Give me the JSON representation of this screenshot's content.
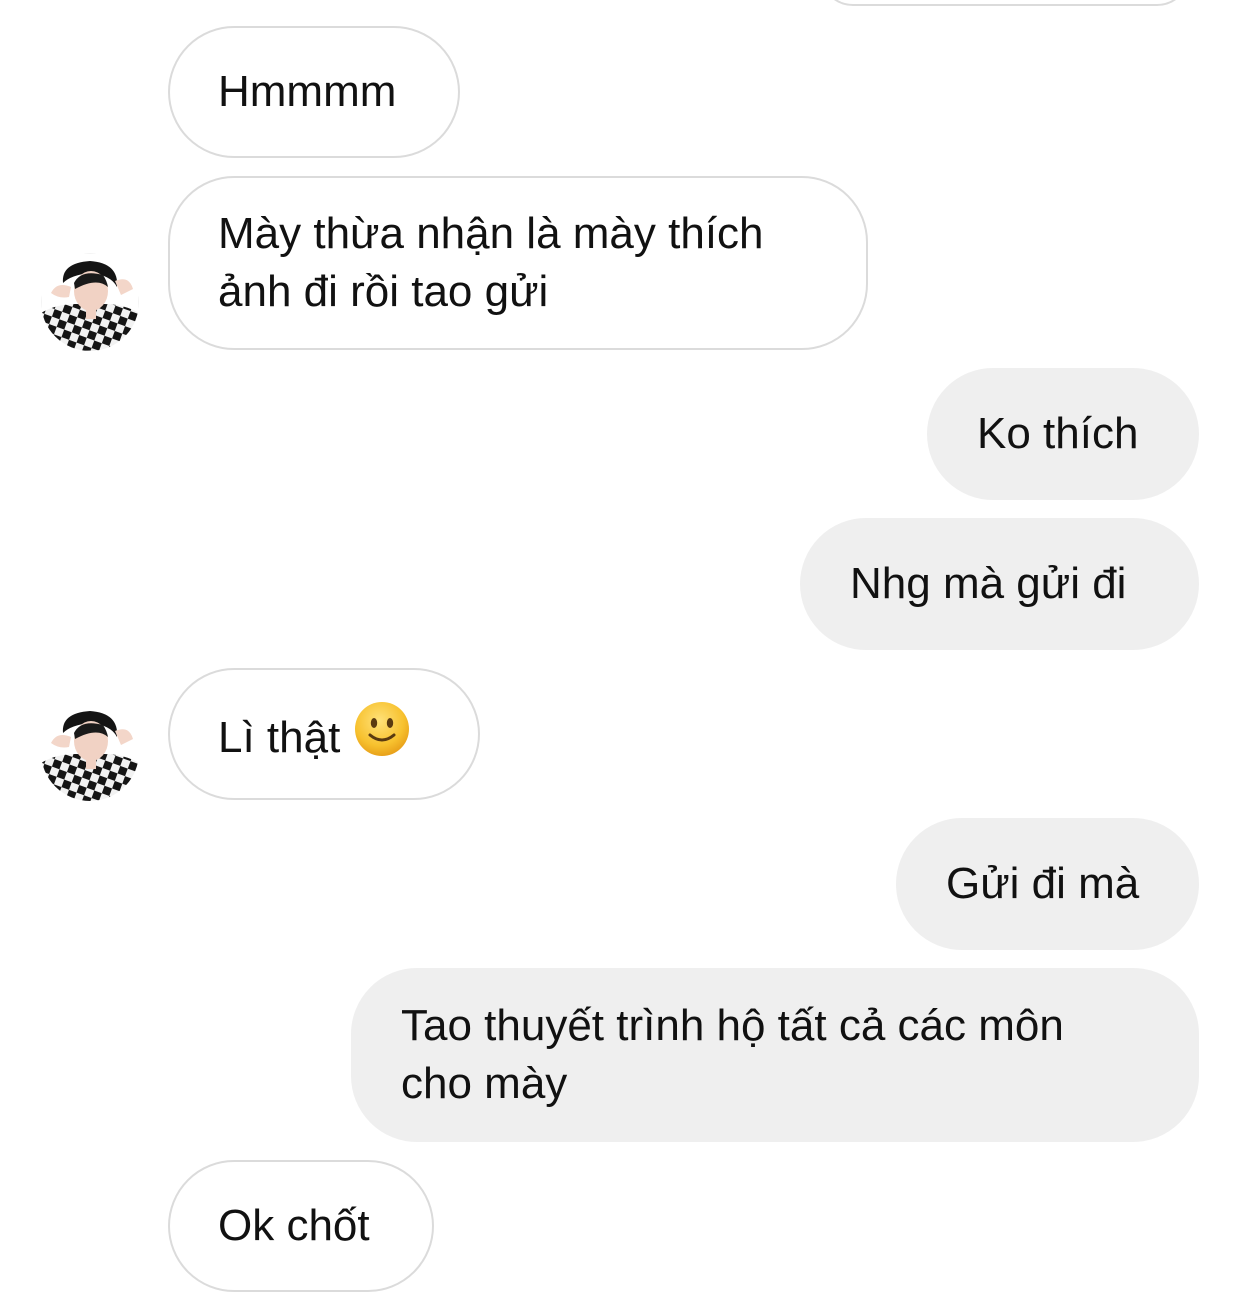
{
  "conversation": {
    "messages": [
      {
        "direction": "in",
        "text": "Hmmmm"
      },
      {
        "direction": "in",
        "line1": "Mày thừa nhận là mày thích",
        "line2": "ảnh đi rồi tao gửi"
      },
      {
        "direction": "out",
        "text": "Ko thích"
      },
      {
        "direction": "out",
        "text": "Nhg mà gửi đi"
      },
      {
        "direction": "in",
        "text": "Lì thật",
        "emoji": "slightly-smiling-face-icon"
      },
      {
        "direction": "out",
        "text": "Gửi đi mà"
      },
      {
        "direction": "out",
        "line1": "Tao thuyết trình hộ tất cả các môn",
        "line2": "cho mày"
      },
      {
        "direction": "in",
        "text": "Ok chốt"
      }
    ]
  },
  "colors": {
    "incoming_bubble_bg": "#ffffff",
    "incoming_bubble_border": "#dbdbdb",
    "outgoing_bubble_bg": "#efefef",
    "text": "#111111",
    "emoji_face": "#f7c12e"
  },
  "icons": {
    "avatar": "contact-avatar-photo",
    "emoji": "slightly-smiling-face-icon"
  }
}
